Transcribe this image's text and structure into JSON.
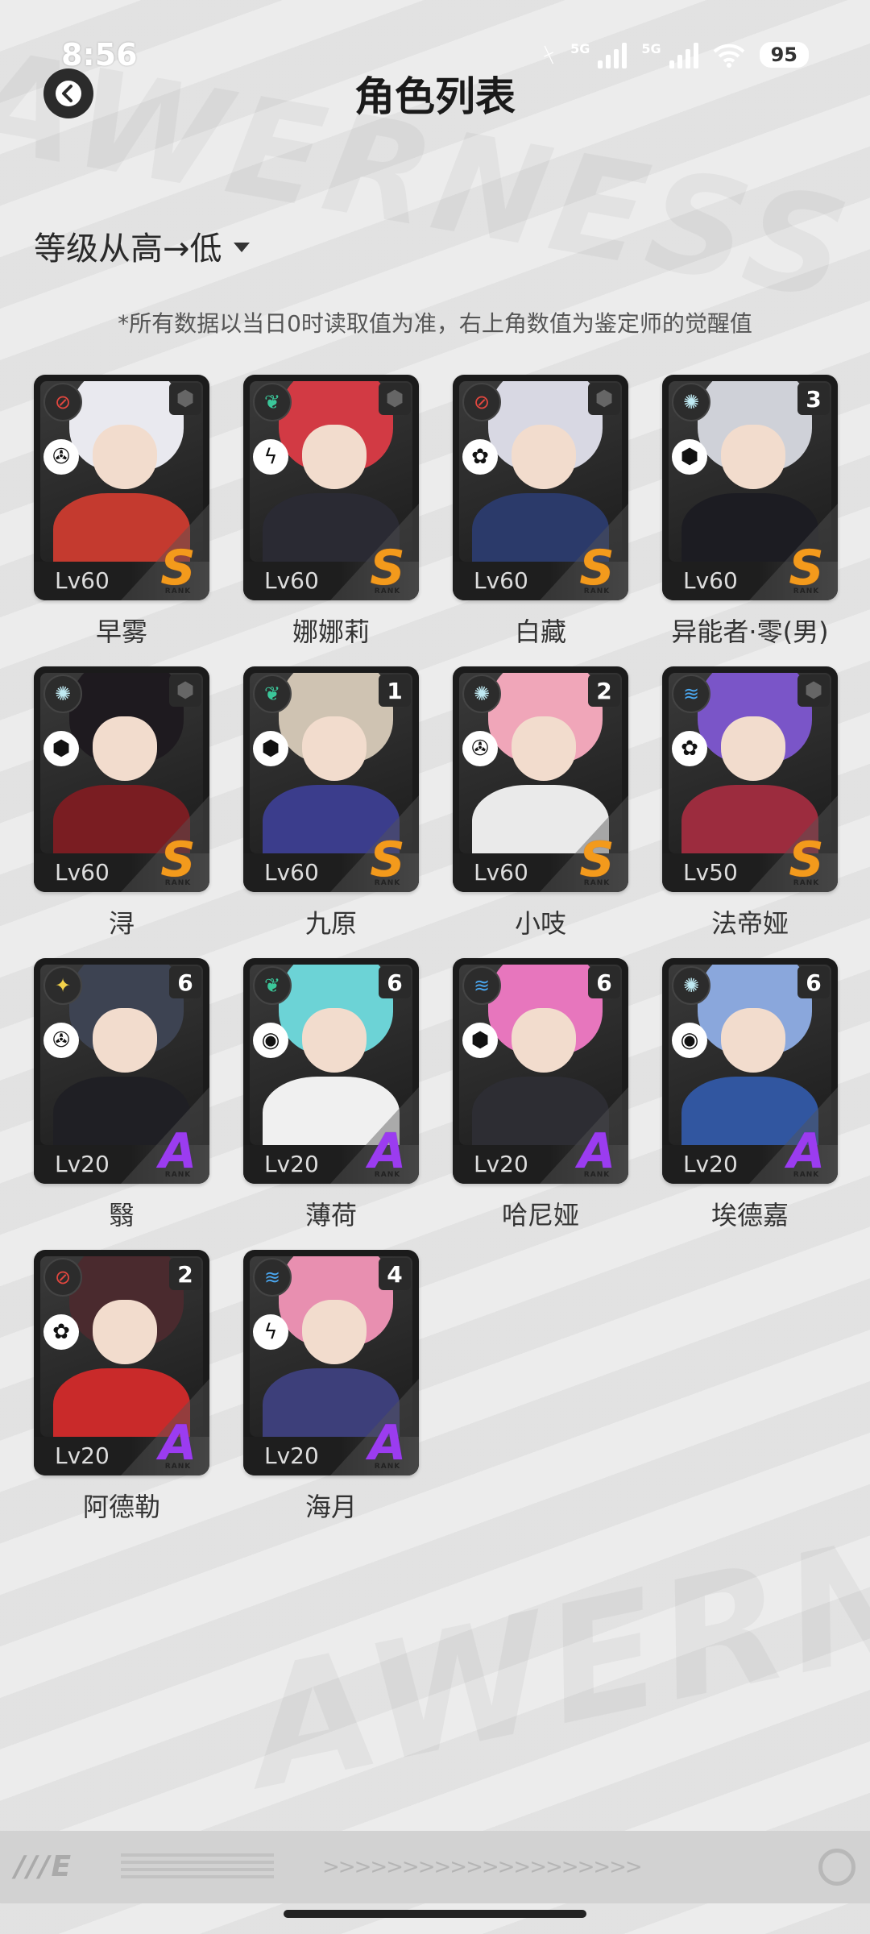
{
  "status_bar": {
    "time": "8:56",
    "network1": "5G",
    "network2": "5G",
    "battery": "95"
  },
  "header": {
    "back_icon": "back-arrow-icon",
    "title": "角色列表"
  },
  "sort": {
    "label": "等级从高→低"
  },
  "note": "*所有数据以当日0时读取值为准，右上角数值为鉴定师的觉醒值",
  "rank_caption": "RANK",
  "colors": {
    "rank_s": "#f39a1c",
    "rank_a": "#9b3cf0"
  },
  "characters": [
    {
      "name": "早雾",
      "level": "Lv60",
      "rank": "S",
      "awakening": "",
      "attribute": "red-crosshair-icon",
      "role": "vortex-icon",
      "hair": "#e9e9ef",
      "body": "#c43a2f"
    },
    {
      "name": "娜娜莉",
      "level": "Lv60",
      "rank": "S",
      "awakening": "",
      "attribute": "green-leaf-icon",
      "role": "lightning-icon",
      "hair": "#d23a44",
      "body": "#2a2a33"
    },
    {
      "name": "白藏",
      "level": "Lv60",
      "rank": "S",
      "awakening": "",
      "attribute": "red-crosshair-icon",
      "role": "flower-icon",
      "hair": "#d8d8e3",
      "body": "#2b3a6a"
    },
    {
      "name": "异能者·零(男)",
      "level": "Lv60",
      "rank": "S",
      "awakening": "3",
      "attribute": "sun-icon",
      "role": "cube-icon",
      "hair": "#cfd1d8",
      "body": "#1c1c22"
    },
    {
      "name": "浔",
      "level": "Lv60",
      "rank": "S",
      "awakening": "",
      "attribute": "sun-icon",
      "role": "cube-icon",
      "hair": "#1e1a1f",
      "body": "#7a1d22"
    },
    {
      "name": "九原",
      "level": "Lv60",
      "rank": "S",
      "awakening": "1",
      "attribute": "green-leaf-icon",
      "role": "cube-icon",
      "hair": "#cfc3b2",
      "body": "#3b3d8c"
    },
    {
      "name": "小吱",
      "level": "Lv60",
      "rank": "S",
      "awakening": "2",
      "attribute": "sun-icon",
      "role": "vortex-icon",
      "hair": "#f0a6b9",
      "body": "#eaeaea"
    },
    {
      "name": "法帝娅",
      "level": "Lv50",
      "rank": "S",
      "awakening": "",
      "attribute": "blue-wave-icon",
      "role": "flower-icon",
      "hair": "#7a55c8",
      "body": "#9c2c3e"
    },
    {
      "name": "翳",
      "level": "Lv20",
      "rank": "A",
      "awakening": "6",
      "attribute": "yellow-star-icon",
      "role": "vortex-icon",
      "hair": "#3d4352",
      "body": "#1f1f24"
    },
    {
      "name": "薄荷",
      "level": "Lv20",
      "rank": "A",
      "awakening": "6",
      "attribute": "green-leaf-icon",
      "role": "swirl-icon",
      "hair": "#6cd3d6",
      "body": "#f0f0f0"
    },
    {
      "name": "哈尼娅",
      "level": "Lv20",
      "rank": "A",
      "awakening": "6",
      "attribute": "blue-wave-icon",
      "role": "cube-icon",
      "hair": "#e776bd",
      "body": "#2d2d33"
    },
    {
      "name": "埃德嘉",
      "level": "Lv20",
      "rank": "A",
      "awakening": "6",
      "attribute": "sun-icon",
      "role": "swirl-icon",
      "hair": "#8aa7dc",
      "body": "#3156a0"
    },
    {
      "name": "阿德勒",
      "level": "Lv20",
      "rank": "A",
      "awakening": "2",
      "attribute": "red-crosshair-icon",
      "role": "flower-icon",
      "hair": "#4a2a2e",
      "body": "#c92a2a"
    },
    {
      "name": "海月",
      "level": "Lv20",
      "rank": "A",
      "awakening": "4",
      "attribute": "blue-wave-icon",
      "role": "lightning-icon",
      "hair": "#e88fb0",
      "body": "#3d3f7a"
    }
  ]
}
